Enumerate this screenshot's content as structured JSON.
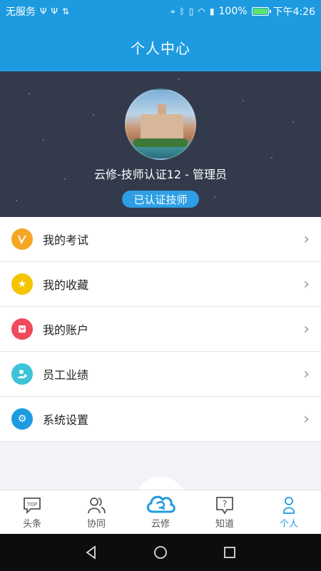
{
  "status_bar": {
    "carrier": "无服务",
    "battery_percent": "100%",
    "time": "下午4:26",
    "battery_level": 1.0
  },
  "header": {
    "title": "个人中心"
  },
  "profile": {
    "name": "云修-技师认证12 - 管理员",
    "badge": "已认证技师"
  },
  "menu": {
    "items": [
      {
        "label": "我的考试",
        "icon": "exam-icon",
        "color": "#f5a623"
      },
      {
        "label": "我的收藏",
        "icon": "star-icon",
        "color": "#f5c400"
      },
      {
        "label": "我的账户",
        "icon": "wallet-icon",
        "color": "#ef4a5d"
      },
      {
        "label": "员工业绩",
        "icon": "staff-icon",
        "color": "#3cc3d8"
      },
      {
        "label": "系统设置",
        "icon": "gear-icon",
        "color": "#1e9be0"
      }
    ]
  },
  "tabs": {
    "headlines": "头条",
    "collab": "协同",
    "yunxiu": "云修",
    "know": "知道",
    "me": "个人",
    "top_badge": "TOP"
  },
  "colors": {
    "primary": "#1e9be0",
    "profile_bg": "#323a4c"
  }
}
